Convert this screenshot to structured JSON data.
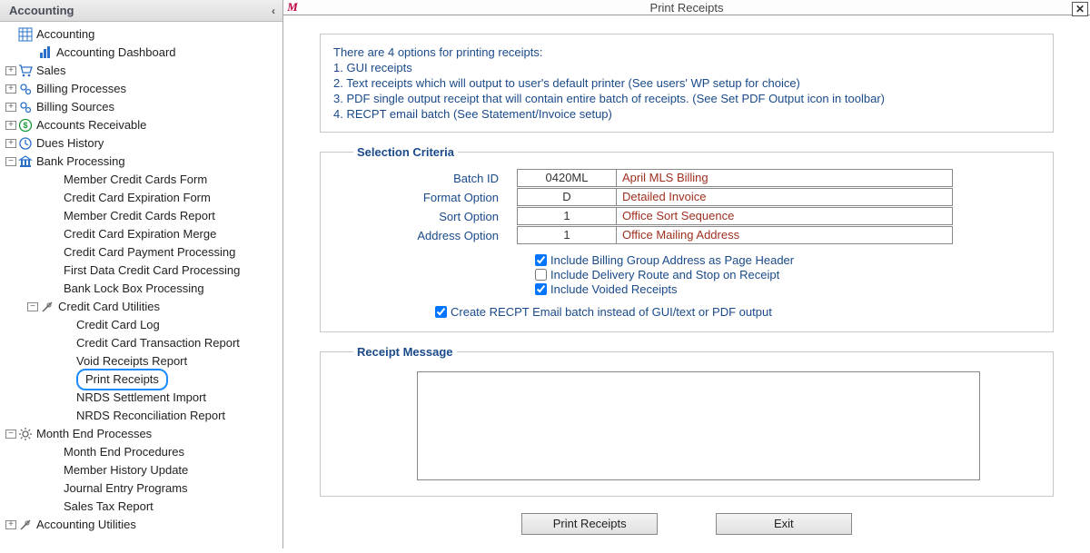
{
  "sidebar": {
    "title": "Accounting",
    "items": [
      {
        "pad": 6,
        "tw": "",
        "iconColor": "#2a70c8",
        "svg": "grid",
        "label": "Accounting"
      },
      {
        "pad": 28,
        "tw": "",
        "iconColor": "#2a70c8",
        "svg": "bars",
        "label": "Accounting Dashboard"
      },
      {
        "pad": 6,
        "tw": "+",
        "iconColor": "#2a70c8",
        "svg": "cart",
        "label": "Sales"
      },
      {
        "pad": 6,
        "tw": "+",
        "iconColor": "#2a70c8",
        "svg": "gears",
        "label": "Billing Processes"
      },
      {
        "pad": 6,
        "tw": "+",
        "iconColor": "#2a70c8",
        "svg": "gears",
        "label": "Billing Sources"
      },
      {
        "pad": 6,
        "tw": "+",
        "iconColor": "#169a3a",
        "svg": "dollar",
        "label": "Accounts Receivable"
      },
      {
        "pad": 6,
        "tw": "+",
        "iconColor": "#2a70c8",
        "svg": "clock",
        "label": "Dues History"
      },
      {
        "pad": 6,
        "tw": "−",
        "iconColor": "#2a70c8",
        "svg": "bank",
        "label": "Bank Processing"
      },
      {
        "pad": 56,
        "tw": "",
        "iconColor": "",
        "svg": "",
        "label": "Member Credit Cards Form"
      },
      {
        "pad": 56,
        "tw": "",
        "iconColor": "",
        "svg": "",
        "label": "Credit Card Expiration Form"
      },
      {
        "pad": 56,
        "tw": "",
        "iconColor": "",
        "svg": "",
        "label": "Member Credit Cards Report"
      },
      {
        "pad": 56,
        "tw": "",
        "iconColor": "",
        "svg": "",
        "label": "Credit Card Expiration Merge"
      },
      {
        "pad": 56,
        "tw": "",
        "iconColor": "",
        "svg": "",
        "label": "Credit Card Payment Processing"
      },
      {
        "pad": 56,
        "tw": "",
        "iconColor": "",
        "svg": "",
        "label": "First Data Credit Card Processing"
      },
      {
        "pad": 56,
        "tw": "",
        "iconColor": "",
        "svg": "",
        "label": "Bank Lock Box Processing"
      },
      {
        "pad": 30,
        "tw": "−",
        "iconColor": "#666",
        "svg": "tools",
        "label": "Credit Card Utilities"
      },
      {
        "pad": 70,
        "tw": "",
        "iconColor": "",
        "svg": "",
        "label": "Credit Card Log"
      },
      {
        "pad": 70,
        "tw": "",
        "iconColor": "",
        "svg": "",
        "label": "Credit Card Transaction Report"
      },
      {
        "pad": 70,
        "tw": "",
        "iconColor": "",
        "svg": "",
        "label": "Void Receipts Report"
      },
      {
        "pad": 70,
        "tw": "",
        "iconColor": "",
        "svg": "",
        "label": "Print Receipts",
        "selected": true
      },
      {
        "pad": 70,
        "tw": "",
        "iconColor": "",
        "svg": "",
        "label": "NRDS Settlement Import"
      },
      {
        "pad": 70,
        "tw": "",
        "iconColor": "",
        "svg": "",
        "label": "NRDS Reconciliation Report"
      },
      {
        "pad": 6,
        "tw": "−",
        "iconColor": "#666",
        "svg": "gear",
        "label": "Month End Processes"
      },
      {
        "pad": 56,
        "tw": "",
        "iconColor": "",
        "svg": "",
        "label": "Month End Procedures"
      },
      {
        "pad": 56,
        "tw": "",
        "iconColor": "",
        "svg": "",
        "label": "Member History Update"
      },
      {
        "pad": 56,
        "tw": "",
        "iconColor": "",
        "svg": "",
        "label": "Journal Entry Programs"
      },
      {
        "pad": 56,
        "tw": "",
        "iconColor": "",
        "svg": "",
        "label": "Sales Tax Report"
      },
      {
        "pad": 6,
        "tw": "+",
        "iconColor": "#666",
        "svg": "tools",
        "label": "Accounting Utilities"
      }
    ]
  },
  "window": {
    "title": "Print Receipts",
    "logo": "M"
  },
  "info": {
    "heading": "There are 4 options for printing receipts:",
    "opt1": "1. GUI receipts",
    "opt2": "2. Text receipts which will output to user's default printer (See users' WP setup for choice)",
    "opt3": "3. PDF single output receipt that will contain entire batch of receipts. (See Set PDF Output icon in toolbar)",
    "opt4": "4. RECPT email batch (See Statement/Invoice setup)"
  },
  "criteria": {
    "legend": "Selection Criteria",
    "rows": [
      {
        "label": "Batch ID",
        "val": "0420ML",
        "desc": "April MLS Billing"
      },
      {
        "label": "Format Option",
        "val": "D",
        "desc": "Detailed Invoice"
      },
      {
        "label": "Sort Option",
        "val": "1",
        "desc": "Office Sort Sequence"
      },
      {
        "label": "Address Option",
        "val": "1",
        "desc": "Office Mailing Address"
      }
    ],
    "checks": [
      {
        "checked": true,
        "label": "Include Billing Group Address as Page Header"
      },
      {
        "checked": false,
        "label": "Include Delivery Route and Stop on Receipt"
      },
      {
        "checked": true,
        "label": "Include Voided Receipts"
      }
    ],
    "emailChecked": true,
    "emailLabel": "Create RECPT Email batch instead of GUI/text or PDF output"
  },
  "msg": {
    "legend": "Receipt Message",
    "value": ""
  },
  "buttons": {
    "print": "Print Receipts",
    "exit": "Exit"
  }
}
